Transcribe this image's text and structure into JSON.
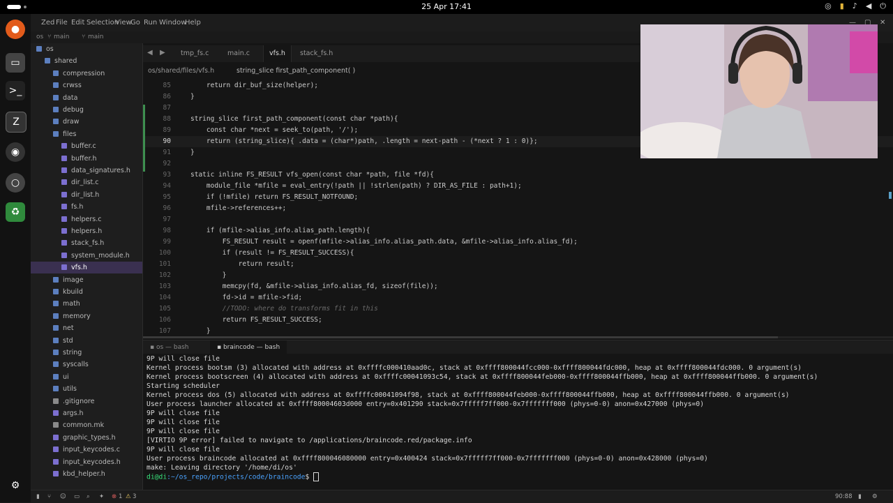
{
  "topbar": {
    "clock": "25 Apr 17:41"
  },
  "window": {
    "menu": [
      "Zed",
      "File",
      "Edit",
      "Selection",
      "View",
      "Go",
      "Run",
      "Window",
      "Help"
    ],
    "project": "os",
    "branch1": "main",
    "branch2": "main"
  },
  "sidebar": {
    "items": [
      {
        "label": "os",
        "indent": 0,
        "kind": "folder-open"
      },
      {
        "label": "shared",
        "indent": 1,
        "kind": "folder-open"
      },
      {
        "label": "compression",
        "indent": 2,
        "kind": "folder"
      },
      {
        "label": "crwss",
        "indent": 2,
        "kind": "folder"
      },
      {
        "label": "data",
        "indent": 2,
        "kind": "folder"
      },
      {
        "label": "debug",
        "indent": 2,
        "kind": "folder"
      },
      {
        "label": "draw",
        "indent": 2,
        "kind": "folder"
      },
      {
        "label": "files",
        "indent": 2,
        "kind": "folder-open"
      },
      {
        "label": "buffer.c",
        "indent": 3,
        "kind": "c"
      },
      {
        "label": "buffer.h",
        "indent": 3,
        "kind": "h"
      },
      {
        "label": "data_signatures.h",
        "indent": 3,
        "kind": "h"
      },
      {
        "label": "dir_list.c",
        "indent": 3,
        "kind": "c"
      },
      {
        "label": "dir_list.h",
        "indent": 3,
        "kind": "h"
      },
      {
        "label": "fs.h",
        "indent": 3,
        "kind": "h"
      },
      {
        "label": "helpers.c",
        "indent": 3,
        "kind": "c"
      },
      {
        "label": "helpers.h",
        "indent": 3,
        "kind": "h"
      },
      {
        "label": "stack_fs.h",
        "indent": 3,
        "kind": "h"
      },
      {
        "label": "system_module.h",
        "indent": 3,
        "kind": "h"
      },
      {
        "label": "vfs.h",
        "indent": 3,
        "kind": "h",
        "selected": true
      },
      {
        "label": "image",
        "indent": 2,
        "kind": "folder"
      },
      {
        "label": "kbuild",
        "indent": 2,
        "kind": "folder"
      },
      {
        "label": "math",
        "indent": 2,
        "kind": "folder"
      },
      {
        "label": "memory",
        "indent": 2,
        "kind": "folder"
      },
      {
        "label": "net",
        "indent": 2,
        "kind": "folder"
      },
      {
        "label": "std",
        "indent": 2,
        "kind": "folder"
      },
      {
        "label": "string",
        "indent": 2,
        "kind": "folder"
      },
      {
        "label": "syscalls",
        "indent": 2,
        "kind": "folder"
      },
      {
        "label": "ui",
        "indent": 2,
        "kind": "folder"
      },
      {
        "label": "utils",
        "indent": 2,
        "kind": "folder"
      },
      {
        "label": ".gitignore",
        "indent": 2,
        "kind": "file"
      },
      {
        "label": "args.h",
        "indent": 2,
        "kind": "h"
      },
      {
        "label": "common.mk",
        "indent": 2,
        "kind": "file"
      },
      {
        "label": "graphic_types.h",
        "indent": 2,
        "kind": "h"
      },
      {
        "label": "input_keycodes.c",
        "indent": 2,
        "kind": "c"
      },
      {
        "label": "input_keycodes.h",
        "indent": 2,
        "kind": "h"
      },
      {
        "label": "kbd_helper.h",
        "indent": 2,
        "kind": "h"
      }
    ]
  },
  "editor": {
    "tabs": [
      {
        "label": "tmp_fs.c"
      },
      {
        "label": "main.c"
      },
      {
        "label": "vfs.h",
        "active": true
      },
      {
        "label": "stack_fs.h"
      }
    ],
    "breadcrumb_path": "os/shared/files/vfs.h",
    "breadcrumb_symbol": "string_slice first_path_component( )",
    "lines": [
      {
        "n": "85",
        "t": "    return dir_buf_size(helper);"
      },
      {
        "n": "86",
        "t": "}"
      },
      {
        "n": "87",
        "t": ""
      },
      {
        "n": "88",
        "t": "string_slice first_path_component(const char *path){"
      },
      {
        "n": "89",
        "t": "    const char *next = seek_to(path, '/');"
      },
      {
        "n": "90",
        "t": "    return (string_slice){ .data = (char*)path, .length = next-path - (*next ? 1 : 0)};",
        "current": true
      },
      {
        "n": "91",
        "t": "}"
      },
      {
        "n": "92",
        "t": ""
      },
      {
        "n": "93",
        "t": "static inline FS_RESULT vfs_open(const char *path, file *fd){"
      },
      {
        "n": "94",
        "t": "    module_file *mfile = eval_entry(!path || !strlen(path) ? DIR_AS_FILE : path+1);"
      },
      {
        "n": "95",
        "t": "    if (!mfile) return FS_RESULT_NOTFOUND;"
      },
      {
        "n": "96",
        "t": "    mfile->references++;"
      },
      {
        "n": "97",
        "t": ""
      },
      {
        "n": "98",
        "t": "    if (mfile->alias_info.alias_path.length){"
      },
      {
        "n": "99",
        "t": "        FS_RESULT result = openf(mfile->alias_info.alias_path.data, &mfile->alias_info.alias_fd);"
      },
      {
        "n": "100",
        "t": "        if (result != FS_RESULT_SUCCESS){"
      },
      {
        "n": "101",
        "t": "            return result;"
      },
      {
        "n": "102",
        "t": "        }"
      },
      {
        "n": "103",
        "t": "        memcpy(fd, &mfile->alias_info.alias_fd, sizeof(file));"
      },
      {
        "n": "104",
        "t": "        fd->id = mfile->fid;"
      },
      {
        "n": "105",
        "t": "        //TODO: where do transforms fit in this"
      },
      {
        "n": "106",
        "t": "        return FS_RESULT_SUCCESS;"
      },
      {
        "n": "107",
        "t": "    }"
      }
    ]
  },
  "terminal": {
    "tabs": [
      {
        "label": "os — bash"
      },
      {
        "label": "braincode — bash",
        "active": true
      }
    ],
    "lines": [
      "9P will close file",
      "Kernel process bootsm (3) allocated with address at 0xffffc000410aad0c, stack at 0xffff800044fcc000-0xffff800044fdc000, heap at 0xffff800044fdc000. 0 argument(s)",
      "Kernel process bootscreen (4) allocated with address at 0xffffc00041093c54, stack at 0xffff800044feb000-0xffff800044ffb000, heap at 0xffff800044ffb000. 0 argument(s)",
      "Starting scheduler",
      "Kernel process dos (5) allocated with address at 0xffffc00041094f98, stack at 0xffff800044feb000-0xffff800044ffb000, heap at 0xffff800044ffb000. 0 argument(s)",
      "User process launcher allocated at 0xffff80004603d000 entry=0x401290 stack=0x7fffff7ff000-0x7fffffff000 (phys=0-0) anon=0x427000 (phys=0)",
      "9P will close file",
      "9P will close file",
      "9P will close file",
      "[VIRTIO 9P error] failed to navigate to /applications/braincode.red/package.info",
      "9P will close file",
      "User process braincode allocated at 0xffff800046080000 entry=0x400424 stack=0x7fffff7ff000-0x7fffffff000 (phys=0-0) anon=0x428000 (phys=0)",
      "make: Leaving directory '/home/di/os'"
    ],
    "prompt_user": "di@di",
    "prompt_path": ":~/os_repo/projects/code/braincode",
    "prompt_symbol": "$ "
  },
  "statusbar": {
    "errors": "1",
    "warnings": "3",
    "position": "90:88"
  },
  "colors": {
    "accent": "#8a7fd4",
    "selection": "#3a3050",
    "keyword": "#c47bd6",
    "function": "#6fb0ff",
    "string": "#e9a36a",
    "constant": "#e4c36e",
    "prompt_user": "#39e07a",
    "prompt_path": "#4aa3ff"
  }
}
